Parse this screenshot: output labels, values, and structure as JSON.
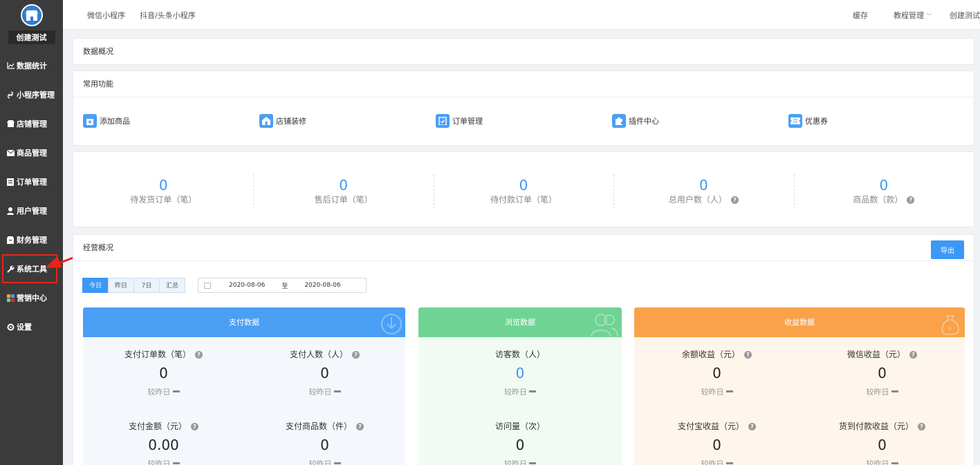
{
  "sidebar": {
    "store_name": "创建测试",
    "items": [
      {
        "label": "数据统计",
        "icon": "chart-line-icon"
      },
      {
        "label": "小程序管理",
        "icon": "link-icon"
      },
      {
        "label": "店铺管理",
        "icon": "store-icon"
      },
      {
        "label": "商品管理",
        "icon": "mail-icon"
      },
      {
        "label": "订单管理",
        "icon": "clipboard-icon"
      },
      {
        "label": "用户管理",
        "icon": "user-icon"
      },
      {
        "label": "财务管理",
        "icon": "wallet-icon"
      },
      {
        "label": "系统工具",
        "icon": "wrench-icon"
      },
      {
        "label": "营销中心",
        "icon": "puzzle-icon"
      },
      {
        "label": "设置",
        "icon": "gear-icon"
      }
    ]
  },
  "topbar": {
    "tabs": [
      "微信小程序",
      "抖音/头条小程序"
    ],
    "cache": "缓存",
    "tutorial": "教程管理",
    "user": "创建测试"
  },
  "overview": {
    "title": "数据概况"
  },
  "common": {
    "title": "常用功能",
    "items": [
      {
        "label": "添加商品",
        "icon": "add-product-icon"
      },
      {
        "label": "店铺装修",
        "icon": "home-icon"
      },
      {
        "label": "订单管理",
        "icon": "clipboard-check-icon"
      },
      {
        "label": "插件中心",
        "icon": "puzzle-icon"
      },
      {
        "label": "优惠券",
        "icon": "ticket-icon"
      }
    ]
  },
  "stats": [
    {
      "value": "0",
      "label": "待发货订单（笔）"
    },
    {
      "value": "0",
      "label": "售后订单（笔）"
    },
    {
      "value": "0",
      "label": "待付款订单（笔）"
    },
    {
      "value": "0",
      "label": "总用户数（人）"
    },
    {
      "value": "0",
      "label": "商品数（款）"
    }
  ],
  "business": {
    "title": "经营概况",
    "export": "导出",
    "range_tabs": [
      "今日",
      "昨日",
      "7日",
      "汇总"
    ],
    "date_from": "2020-08-06",
    "date_sep": "至",
    "date_to": "2020-08-06"
  },
  "panels": {
    "pay": {
      "title": "支付数据",
      "color": "#4a9ff5",
      "body_color": "#f4f8fd",
      "metrics": [
        {
          "label": "支付订单数（笔）",
          "value": "0",
          "compare": "较昨日"
        },
        {
          "label": "支付人数（人）",
          "value": "0",
          "compare": "较昨日"
        },
        {
          "label": "支付金额（元）",
          "value": "0.00",
          "compare": "较昨日"
        },
        {
          "label": "支付商品数（件）",
          "value": "0",
          "compare": "较昨日"
        }
      ]
    },
    "browse": {
      "title": "浏览数据",
      "color": "#6fd394",
      "body_color": "#f1fbf4",
      "metrics": [
        {
          "label": "访客数（人）",
          "value": "0",
          "compare": "较昨日"
        },
        {
          "label": "访问量（次）",
          "value": "0",
          "compare": "较昨日"
        }
      ]
    },
    "income": {
      "title": "收益数据",
      "color": "#f9a24a",
      "body_color": "#fef6ec",
      "metrics": [
        {
          "label": "余额收益（元）",
          "value": "0",
          "compare": "较昨日"
        },
        {
          "label": "微信收益（元）",
          "value": "0",
          "compare": "较昨日"
        },
        {
          "label": "支付宝收益（元）",
          "value": "0",
          "compare": "较昨日"
        },
        {
          "label": "货到付款收益（元）",
          "value": "0",
          "compare": "较昨日"
        }
      ]
    }
  }
}
